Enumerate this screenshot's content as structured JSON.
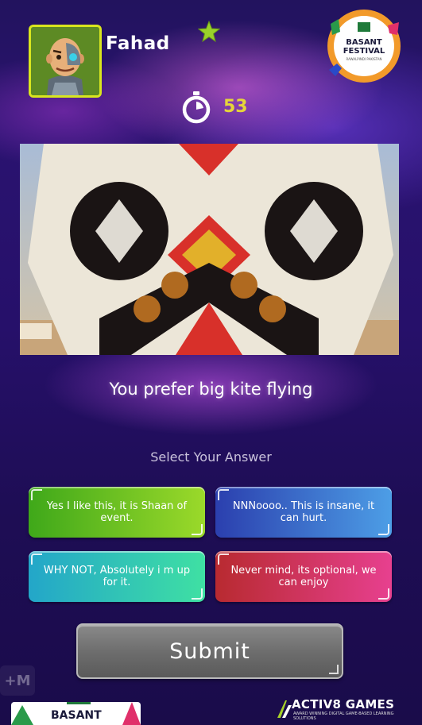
{
  "player": {
    "name": "Fahad"
  },
  "festival_logo": {
    "line1": "BASANT",
    "line2": "FESTIVAL",
    "line3": "RAWALPINDI PAKISTAN"
  },
  "timer": {
    "seconds": "53"
  },
  "question": {
    "text": "You prefer big kite flying"
  },
  "prompt": "Select Your Answer",
  "answers": [
    {
      "label": "Yes I like this, it is Shaan of event.",
      "color_from": "#3fa81a",
      "color_to": "#9bd92a"
    },
    {
      "label": "NNNoooo.. This is insane, it can hurt.",
      "color_from": "#2b3fae",
      "color_to": "#4d9ee6"
    },
    {
      "label": "WHY NOT, Absolutely i m up for it.",
      "color_from": "#23a6c9",
      "color_to": "#3fe0a3"
    },
    {
      "label": "Never mind, its optional, we can enjoy",
      "color_from": "#b82a30",
      "color_to": "#e7408f"
    }
  ],
  "submit_label": "Submit",
  "zoom_label": "+M",
  "bottom_banner": {
    "text": "BASANT"
  },
  "branding": {
    "name": "ACTIV8 GAMES",
    "tagline": "AWARD WINNING DIGITAL GAME-BASED LEARNING SOLUTIONS"
  },
  "colors": {
    "accent_yellow": "#e6d63a",
    "avatar_border": "#d9e61e",
    "background": "#1c0f4a"
  }
}
